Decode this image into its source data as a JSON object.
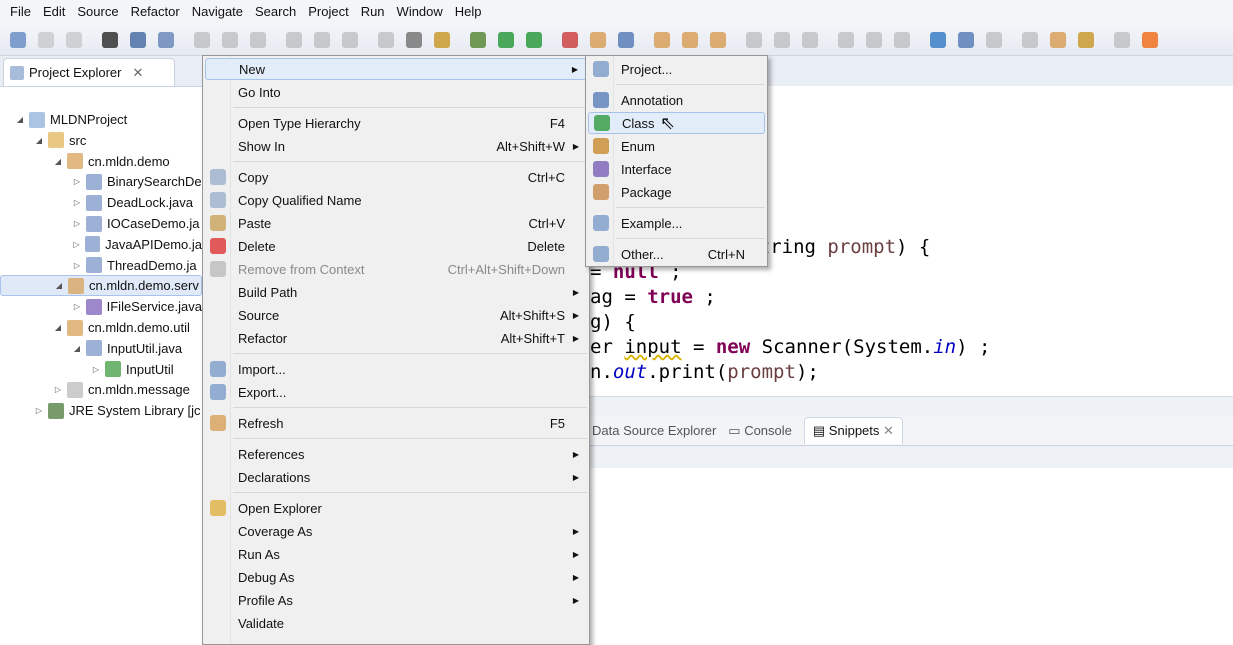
{
  "menubar": [
    "File",
    "Edit",
    "Source",
    "Refactor",
    "Navigate",
    "Search",
    "Project",
    "Run",
    "Window",
    "Help"
  ],
  "project_explorer": {
    "tab_label": "Project Explorer",
    "tree": [
      {
        "label": "MLDNProject",
        "depth": 0,
        "twisty": "expanded",
        "icon": "project-icon",
        "color": "#8fb0d8"
      },
      {
        "label": "src",
        "depth": 1,
        "twisty": "expanded",
        "icon": "source-folder-icon",
        "color": "#e2b65a"
      },
      {
        "label": "cn.mldn.demo",
        "depth": 2,
        "twisty": "expanded",
        "icon": "package-icon",
        "color": "#d8a05a"
      },
      {
        "label": "BinarySearchDe",
        "depth": 3,
        "twisty": "collapsed",
        "icon": "java-file-icon",
        "color": "#7b97c7"
      },
      {
        "label": "DeadLock.java",
        "depth": 3,
        "twisty": "collapsed",
        "icon": "java-file-icon",
        "color": "#7b97c7"
      },
      {
        "label": "IOCaseDemo.ja",
        "depth": 3,
        "twisty": "collapsed",
        "icon": "java-file-icon",
        "color": "#7b97c7"
      },
      {
        "label": "JavaAPIDemo.ja",
        "depth": 3,
        "twisty": "collapsed",
        "icon": "java-file-icon",
        "color": "#7b97c7"
      },
      {
        "label": "ThreadDemo.ja",
        "depth": 3,
        "twisty": "collapsed",
        "icon": "java-file-icon",
        "color": "#7b97c7"
      },
      {
        "label": "cn.mldn.demo.serv",
        "depth": 2,
        "twisty": "expanded",
        "icon": "package-icon",
        "color": "#d8a05a",
        "selected": true
      },
      {
        "label": "IFileService.java",
        "depth": 3,
        "twisty": "collapsed",
        "icon": "java-interface-file-icon",
        "color": "#7b60b8"
      },
      {
        "label": "cn.mldn.demo.util",
        "depth": 2,
        "twisty": "expanded",
        "icon": "package-icon",
        "color": "#d8a05a"
      },
      {
        "label": "InputUtil.java",
        "depth": 3,
        "twisty": "expanded",
        "icon": "java-file-icon",
        "color": "#7b97c7"
      },
      {
        "label": "InputUtil",
        "depth": 4,
        "twisty": "collapsed",
        "icon": "class-icon",
        "color": "#3f9b3f"
      },
      {
        "label": "cn.mldn.message",
        "depth": 2,
        "twisty": "collapsed",
        "icon": "empty-package-icon",
        "color": "#bbbbbb"
      },
      {
        "label": "JRE System Library [jc",
        "depth": 1,
        "twisty": "collapsed",
        "icon": "library-icon",
        "color": "#4a7a3a"
      }
    ]
  },
  "context_menu": [
    {
      "label": "New",
      "arrow": true,
      "icon": "",
      "highlight": true
    },
    {
      "label": "Go Into"
    },
    {
      "sep": true
    },
    {
      "label": "Open Type Hierarchy",
      "shortcut": "F4"
    },
    {
      "label": "Show In",
      "shortcut": "Alt+Shift+W",
      "arrow": true
    },
    {
      "sep": true
    },
    {
      "label": "Copy",
      "shortcut": "Ctrl+C",
      "icon": "copy-icon"
    },
    {
      "label": "Copy Qualified Name",
      "icon": "copy-icon"
    },
    {
      "label": "Paste",
      "shortcut": "Ctrl+V",
      "icon": "paste-icon"
    },
    {
      "label": "Delete",
      "shortcut": "Delete",
      "icon": "delete-icon"
    },
    {
      "label": "Remove from Context",
      "shortcut": "Ctrl+Alt+Shift+Down",
      "disabled": true,
      "icon": "remove-context-icon"
    },
    {
      "label": "Build Path",
      "arrow": true
    },
    {
      "label": "Source",
      "shortcut": "Alt+Shift+S",
      "arrow": true
    },
    {
      "label": "Refactor",
      "shortcut": "Alt+Shift+T",
      "arrow": true
    },
    {
      "sep": true
    },
    {
      "label": "Import...",
      "icon": "import-icon"
    },
    {
      "label": "Export...",
      "icon": "export-icon"
    },
    {
      "sep": true
    },
    {
      "label": "Refresh",
      "shortcut": "F5",
      "icon": "refresh-icon"
    },
    {
      "sep": true
    },
    {
      "label": "References",
      "arrow": true
    },
    {
      "label": "Declarations",
      "arrow": true
    },
    {
      "sep": true
    },
    {
      "label": "Open Explorer",
      "icon": "folder-icon"
    },
    {
      "label": "Coverage As",
      "arrow": true
    },
    {
      "label": "Run As",
      "arrow": true
    },
    {
      "label": "Debug As",
      "arrow": true
    },
    {
      "label": "Profile As",
      "arrow": true
    },
    {
      "label": "Validate"
    }
  ],
  "submenu_new": [
    {
      "label": "Project...",
      "icon": "new-project-icon"
    },
    {
      "sep": true
    },
    {
      "label": "Annotation",
      "icon": "annotation-icon"
    },
    {
      "label": "Class",
      "icon": "new-class-icon",
      "highlight": true
    },
    {
      "label": "Enum",
      "icon": "enum-icon"
    },
    {
      "label": "Interface",
      "icon": "interface-icon"
    },
    {
      "label": "Package",
      "icon": "package-icon"
    },
    {
      "sep": true
    },
    {
      "label": "Example...",
      "icon": "example-icon"
    },
    {
      "sep": true
    },
    {
      "label": "Other...",
      "shortcut": "Ctrl+N",
      "icon": "other-icon"
    }
  ],
  "editor": {
    "lines": [
      "ng(String prompt) {",
      "= null ;",
      "ag = true ;",
      "g) {",
      "er input = new Scanner(System.in) ;",
      "n.out.print(prompt);"
    ]
  },
  "bottom_tabs": [
    "Data Source Explorer",
    "Console",
    "Snippets"
  ]
}
